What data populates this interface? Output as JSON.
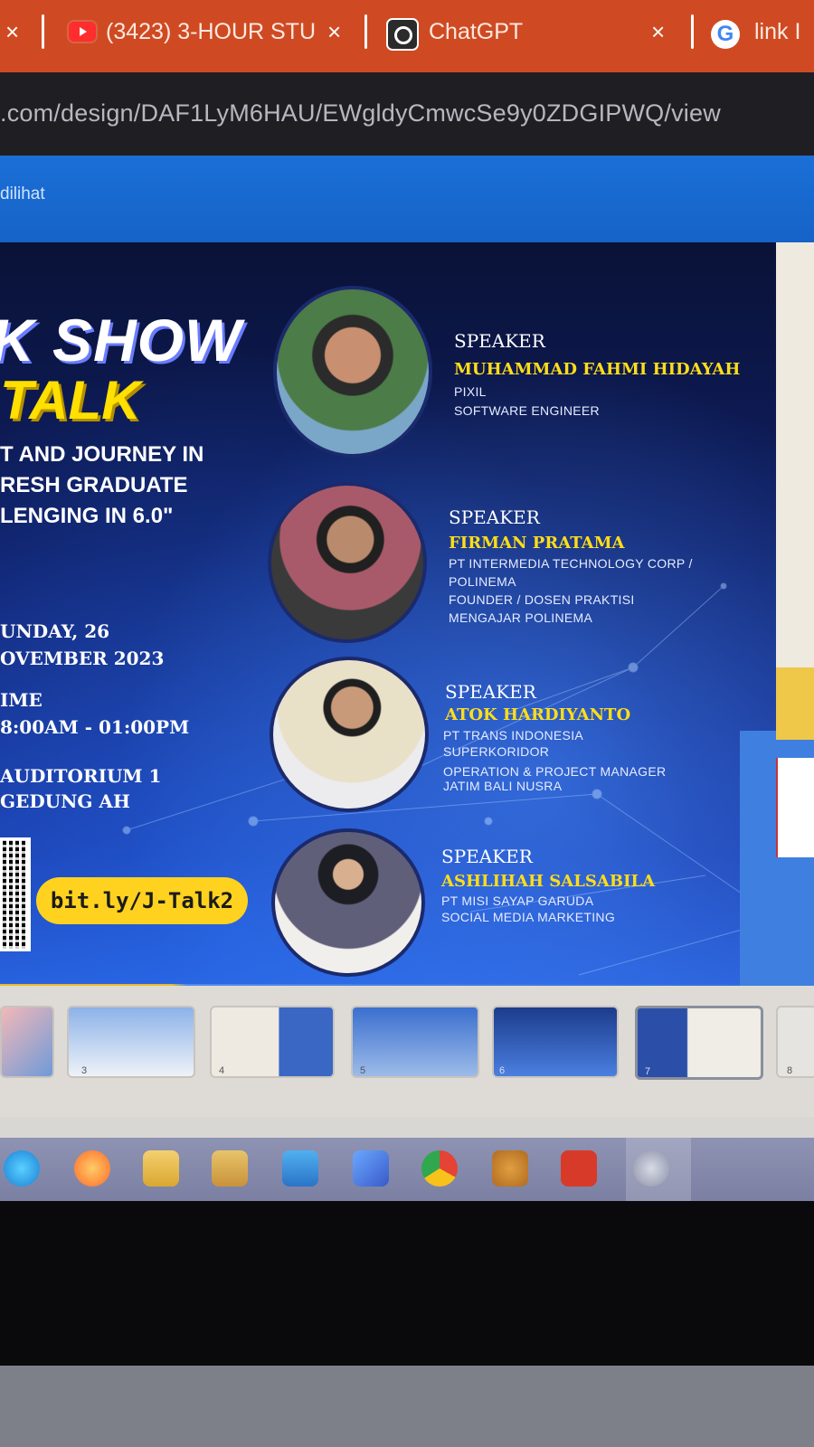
{
  "browser": {
    "tabs": [
      {
        "label": "(3423) 3-HOUR STU",
        "icon": "youtube-icon"
      },
      {
        "label": "ChatGPT",
        "icon": "chatgpt-icon"
      },
      {
        "label": "link I",
        "icon": "google-icon"
      }
    ],
    "close_glyph": "×",
    "url": ".com/design/DAF1LyM6HAU/EWgldyCmwcSe9y0ZDGIPWQ/view",
    "infobar_text": "dilihat"
  },
  "poster": {
    "title_line1": "K SHOW",
    "title_line2": "TALK",
    "subtitle_lines": [
      "T AND JOURNEY IN",
      "RESH GRADUATE",
      "LENGING IN 6.0\""
    ],
    "date_line1": "UNDAY, 26",
    "date_line2": "OVEMBER 2023",
    "time_label": "IME",
    "time_value": "8:00AM - 01:00PM",
    "venue_line1": "AUDITORIUM 1",
    "venue_line2": "GEDUNG AH",
    "link": "bit.ly/J-Talk2",
    "speakers": [
      {
        "label": "SPEAKER",
        "name": "MUHAMMAD FAHMI HIDAYAH",
        "lines": [
          "PIXIL",
          "SOFTWARE ENGINEER"
        ]
      },
      {
        "label": "SPEAKER",
        "name": "FIRMAN PRATAMA",
        "lines": [
          "PT INTERMEDIA TECHNOLOGY CORP /",
          "POLINEMA",
          "FOUNDER / DOSEN PRAKTISI",
          "MENGAJAR POLINEMA"
        ]
      },
      {
        "label": "SPEAKER",
        "name": "ATOK HARDIYANTO",
        "lines": [
          "PT TRANS INDONESIA",
          "SUPERKORIDOR",
          "OPERATION & PROJECT MANAGER",
          "JATIM BALI NUSRA"
        ]
      },
      {
        "label": "SPEAKER",
        "name": "ASHLIHAH SALSABILA",
        "lines": [
          "PT MISI SAYAP GARUDA",
          "SOCIAL MEDIA MARKETING"
        ]
      }
    ]
  },
  "thumbnails": [
    {
      "num": "3"
    },
    {
      "num": "4"
    },
    {
      "num": "5"
    },
    {
      "num": "6"
    },
    {
      "num": "7"
    },
    {
      "num": "8"
    }
  ],
  "taskbar_icons": [
    "edge-icon",
    "firefox-icon",
    "file-explorer-icon",
    "store-icon",
    "mail-icon",
    "vscode-icon",
    "chrome-icon",
    "app-icon",
    "pdf-icon",
    "active-app-icon"
  ],
  "colors": {
    "tabbar": "#cf4a22",
    "address_bar": "#1f1f23",
    "infobar": "#1a6fd6",
    "poster_blue": "#1a3aa8",
    "accent_yellow": "#ffdd1a"
  }
}
